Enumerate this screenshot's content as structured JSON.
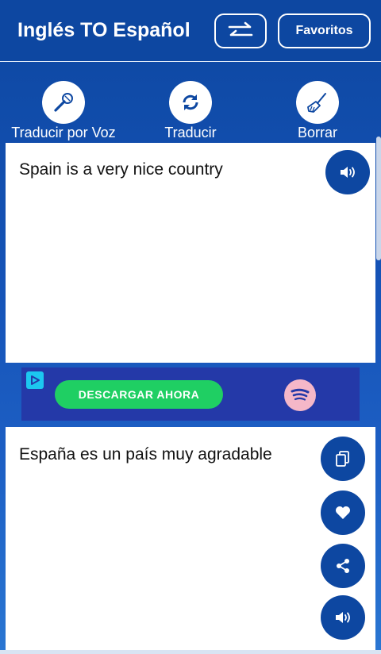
{
  "header": {
    "title": "Inglés TO Español",
    "swap_icon": "swap-arrows-icon",
    "favorites_label": "Favoritos"
  },
  "actions": [
    {
      "label": "Traducir por Voz",
      "icon": "microphone-icon"
    },
    {
      "label": "Traducir",
      "icon": "refresh-icon"
    },
    {
      "label": "Borrar",
      "icon": "broom-icon"
    }
  ],
  "source": {
    "text": "Spain is a very nice country",
    "speak_icon": "speaker-icon"
  },
  "ad": {
    "cta_label": "DESCARGAR AHORA",
    "logo_icon": "spotify-logo-icon",
    "badge_icon": "ad-choices-icon"
  },
  "result": {
    "text": "España es un país muy agradable",
    "buttons": [
      "copy-icon",
      "heart-icon",
      "share-icon",
      "speaker-icon"
    ]
  },
  "colors": {
    "primary": "#0d47a1",
    "ad_background": "#2439a8",
    "ad_cta": "#1fcf63",
    "panel": "#ffffff"
  }
}
